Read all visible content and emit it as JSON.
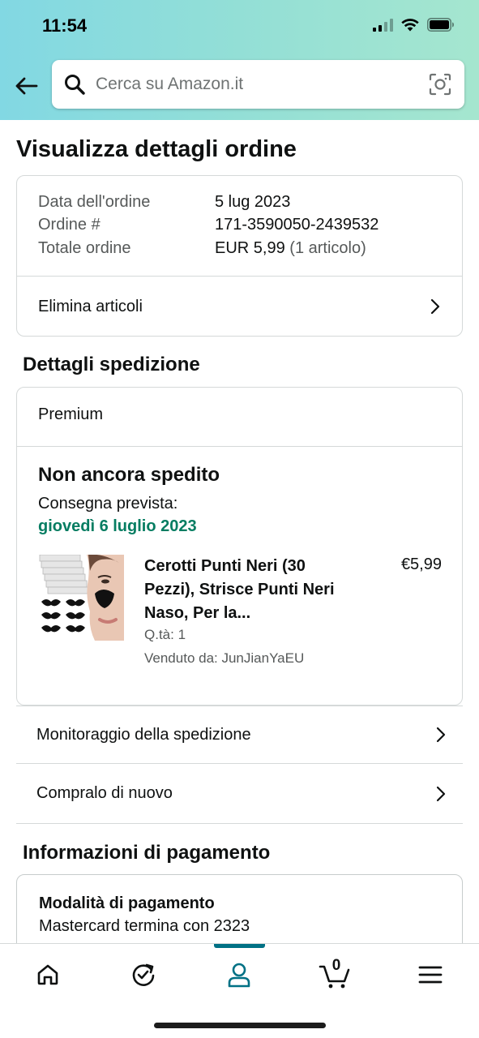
{
  "status_bar": {
    "time": "11:54"
  },
  "search": {
    "placeholder": "Cerca su Amazon.it"
  },
  "page": {
    "title": "Visualizza dettagli ordine"
  },
  "order_summary": {
    "date_label": "Data dell'ordine",
    "date_value": "5 lug 2023",
    "number_label": "Ordine #",
    "number_value": "171-3590050-2439532",
    "total_label": "Totale ordine",
    "total_value": "EUR 5,99",
    "total_items": "(1 articolo)",
    "delete_items_label": "Elimina articoli"
  },
  "shipping": {
    "section_title": "Dettagli spedizione",
    "service": "Premium",
    "status": "Non ancora spedito",
    "delivery_label": "Consegna prevista:",
    "delivery_date": "giovedì 6 luglio 2023",
    "delivery_date_color": "#067d62",
    "product": {
      "title": "Cerotti Punti Neri (30 Pezzi), Strisce Punti Neri Naso, Per la...",
      "price": "€5,99",
      "quantity": "Q.tà: 1",
      "seller": "Venduto da: JunJianYaEU"
    }
  },
  "actions": {
    "track_label": "Monitoraggio della spedizione",
    "buy_again_label": "Compralo di nuovo"
  },
  "payment": {
    "section_title": "Informazioni di pagamento",
    "method_label": "Modalità di pagamento",
    "method_value": "Mastercard termina con 2323"
  },
  "bottom_nav": {
    "items": [
      "home-icon",
      "updates-icon",
      "account-icon",
      "cart-icon",
      "menu-icon"
    ],
    "active": "account-icon",
    "cart_count": "0",
    "accent_color": "#007185"
  }
}
